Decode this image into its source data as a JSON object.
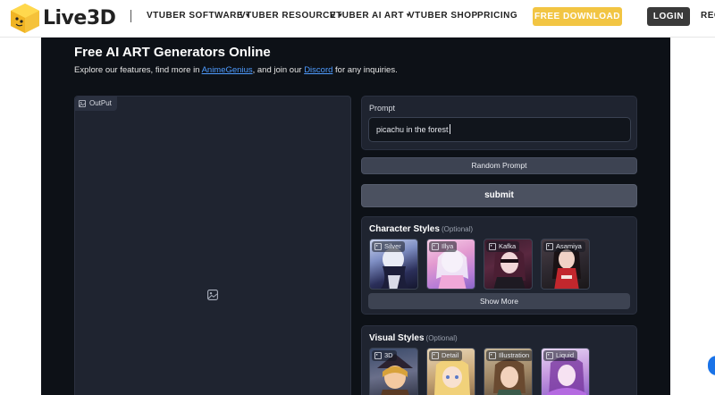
{
  "nav": {
    "logo_text": "Live3D",
    "items": [
      {
        "label": "VTUBER SOFTWARE",
        "has_dropdown": true
      },
      {
        "label": "VTUBER RESOURCE",
        "has_dropdown": true
      },
      {
        "label": "VTUBER AI ART",
        "has_dropdown": true
      },
      {
        "label": "VTUBER SHOP",
        "has_dropdown": false
      },
      {
        "label": "PRICING",
        "has_dropdown": false
      }
    ],
    "download_label": "FREE DOWNLOAD",
    "login_label": "LOGIN",
    "register_label": "REG",
    "caret": "▾"
  },
  "app": {
    "title": "Free AI ART Generators Online",
    "subtitle_pre": "Explore our features, find more in ",
    "subtitle_link1": "AnimeGenius",
    "subtitle_mid": ", and join our ",
    "subtitle_link2": "Discord",
    "subtitle_post": " for any inquiries."
  },
  "output": {
    "label": "OutPut"
  },
  "prompt": {
    "label": "Prompt",
    "value": "picachu in the forest"
  },
  "random_prompt_label": "Random Prompt",
  "submit_label": "submit",
  "character_styles": {
    "title": "Character Styles",
    "optional": "(Optional)",
    "items": [
      "Silver",
      "Illya",
      "Kafka",
      "Asamiya"
    ],
    "show_more": "Show More"
  },
  "visual_styles": {
    "title": "Visual Styles",
    "optional": "(Optional)",
    "items": [
      "3D",
      "Detail",
      "Illustration",
      "Liquid"
    ]
  },
  "colors": {
    "accent_yellow": "#f2c543",
    "panel_bg": "#0d1117",
    "card_bg": "#1f2430",
    "link_blue": "#4f9cff"
  }
}
